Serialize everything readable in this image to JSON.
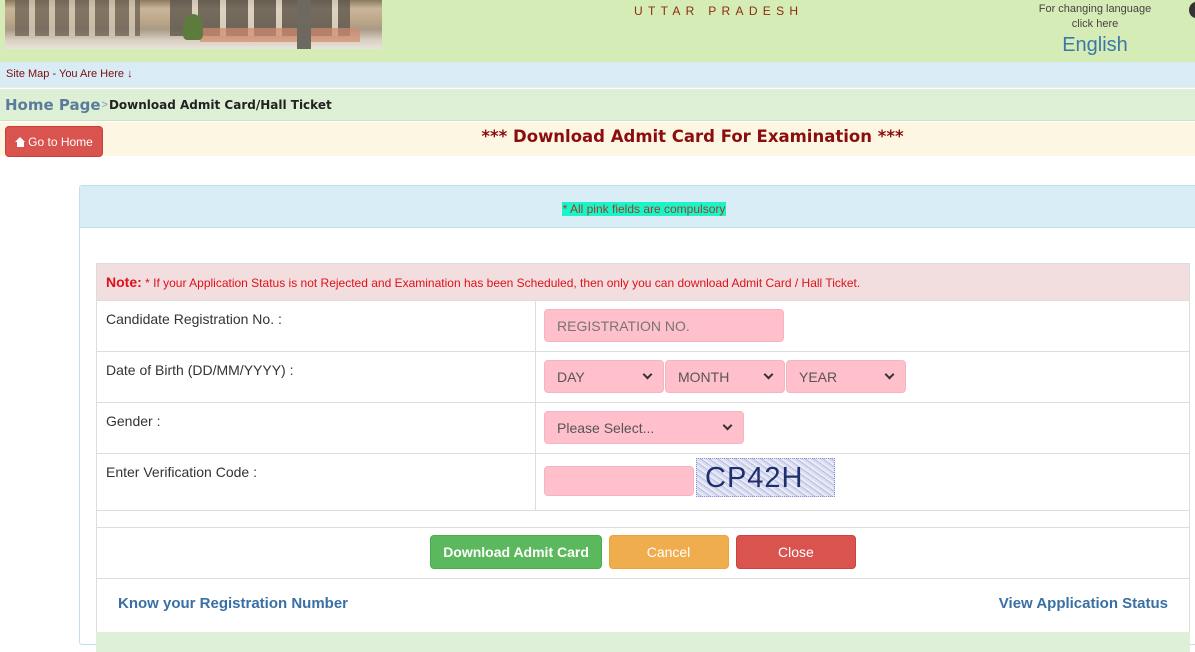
{
  "header": {
    "state_name": "UTTAR PRADESH",
    "language_hint_line1": "For changing language",
    "language_hint_line2": "click here",
    "language_link": "English"
  },
  "sitemap": {
    "label": "Site Map - You Are Here ↓"
  },
  "breadcrumb": {
    "home": "Home Page",
    "separator": ">",
    "current": "Download Admit Card/Hall Ticket"
  },
  "title_strip": {
    "go_home_label": "Go to Home",
    "go_home_icon": "home-icon",
    "page_title": "*** Download Admit Card For Examination ***"
  },
  "panel": {
    "compulsory_notice": "* All pink fields are compulsory",
    "note_label": "Note:",
    "note_text": " * If your Application Status is not Rejected and Examination has been Scheduled, then only you can download Admit Card / Hall Ticket."
  },
  "form": {
    "registration": {
      "label": "Candidate Registration No. :",
      "placeholder": "REGISTRATION NO.",
      "value": ""
    },
    "dob": {
      "label": "Date of Birth (DD/MM/YYYY) :",
      "day_selected": "DAY",
      "month_selected": "MONTH",
      "year_selected": "YEAR"
    },
    "gender": {
      "label": "Gender :",
      "selected": "Please Select..."
    },
    "verification": {
      "label": "Enter Verification Code :",
      "value": "",
      "captcha_text": "CP42H"
    }
  },
  "buttons": {
    "download": "Download Admit Card",
    "cancel": "Cancel",
    "close": "Close"
  },
  "links": {
    "know_registration": "Know your Registration Number",
    "view_status": "View Application Status"
  },
  "colors": {
    "header_bg": "#d6ecb6",
    "pink_field": "#ffc0cb",
    "title_color": "#8b0e0e",
    "note_color": "#e0101b",
    "success": "#5cb85c",
    "warning": "#f0ad4e",
    "danger": "#d9534f",
    "link": "#3a6fa3"
  }
}
